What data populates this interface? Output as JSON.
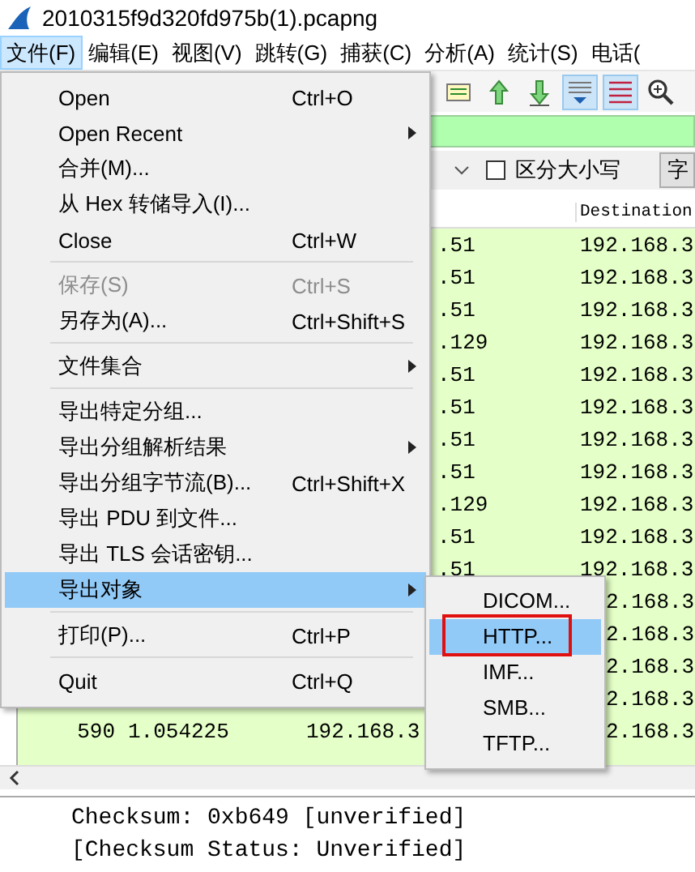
{
  "window": {
    "title": "2010315f9d320fd975b(1).pcapng"
  },
  "menubar": [
    {
      "label": "文件(F)",
      "selected": true
    },
    {
      "label": "编辑(E)",
      "selected": false
    },
    {
      "label": "视图(V)",
      "selected": false
    },
    {
      "label": "跳转(G)",
      "selected": false
    },
    {
      "label": "捕获(C)",
      "selected": false
    },
    {
      "label": "分析(A)",
      "selected": false
    },
    {
      "label": "统计(S)",
      "selected": false
    },
    {
      "label": "电话(",
      "selected": false
    }
  ],
  "toolbar": [
    {
      "pressed": false
    },
    {
      "pressed": false
    },
    {
      "pressed": false
    },
    {
      "pressed": true
    },
    {
      "pressed": true
    },
    {
      "pressed": false
    }
  ],
  "search": {
    "case_sensitive": {
      "label": "区分大小写",
      "checked": false
    },
    "button": "字"
  },
  "table": {
    "columns": [
      "Destination"
    ],
    "rows": [
      {
        "kind": "menu",
        "source": ".51",
        "destination": "192.168.3"
      },
      {
        "kind": "menu",
        "source": ".51",
        "destination": "192.168.3"
      },
      {
        "kind": "menu",
        "source": ".51",
        "destination": "192.168.3"
      },
      {
        "kind": "menu",
        "source": ".129",
        "destination": "192.168.3"
      },
      {
        "kind": "menu",
        "source": ".51",
        "destination": "192.168.3"
      },
      {
        "kind": "menu",
        "source": ".51",
        "destination": "192.168.3"
      },
      {
        "kind": "menu",
        "source": ".51",
        "destination": "192.168.3"
      },
      {
        "kind": "menu",
        "source": ".51",
        "destination": "192.168.3"
      },
      {
        "kind": "menu",
        "source": ".129",
        "destination": "192.168.3"
      },
      {
        "kind": "menu",
        "source": ".51",
        "destination": "192.168.3"
      },
      {
        "kind": "menu",
        "source": ".51",
        "destination": "192.168.3"
      },
      {
        "kind": "submenu",
        "destination": "2.168.3"
      },
      {
        "kind": "submenu",
        "destination": "2.168.3"
      },
      {
        "kind": "submenu",
        "destination": "2.168.3"
      },
      {
        "kind": "submenu",
        "destination": "2.168.3"
      },
      {
        "kind": "submenu",
        "no": "590",
        "time": "1.054225",
        "source": "192.168.3",
        "destination": "2.168.3"
      }
    ]
  },
  "details": [
    "Checksum: 0xb649 [unverified]",
    "[Checksum Status: Unverified]"
  ],
  "file_menu": [
    {
      "kind": "item",
      "label": "Open",
      "shortcut": "Ctrl+O",
      "submenu": false,
      "disabled": false,
      "selected": false
    },
    {
      "kind": "item",
      "label": "Open Recent",
      "submenu": true,
      "disabled": false,
      "selected": false
    },
    {
      "kind": "item",
      "label": "合并(M)...",
      "submenu": false,
      "disabled": false,
      "selected": false
    },
    {
      "kind": "item",
      "label": "从 Hex 转储导入(I)...",
      "submenu": false,
      "disabled": false,
      "selected": false
    },
    {
      "kind": "item",
      "label": "Close",
      "shortcut": "Ctrl+W",
      "submenu": false,
      "disabled": false,
      "selected": false
    },
    {
      "kind": "separator"
    },
    {
      "kind": "item",
      "label": "保存(S)",
      "shortcut": "Ctrl+S",
      "submenu": false,
      "disabled": true,
      "selected": false
    },
    {
      "kind": "item",
      "label": "另存为(A)...",
      "shortcut": "Ctrl+Shift+S",
      "submenu": false,
      "disabled": false,
      "selected": false
    },
    {
      "kind": "separator"
    },
    {
      "kind": "item",
      "label": "文件集合",
      "submenu": true,
      "disabled": false,
      "selected": false
    },
    {
      "kind": "separator"
    },
    {
      "kind": "item",
      "label": "导出特定分组...",
      "submenu": false,
      "disabled": false,
      "selected": false
    },
    {
      "kind": "item",
      "label": "导出分组解析结果",
      "submenu": true,
      "disabled": false,
      "selected": false
    },
    {
      "kind": "item",
      "label": "导出分组字节流(B)...",
      "shortcut": "Ctrl+Shift+X",
      "submenu": false,
      "disabled": false,
      "selected": false
    },
    {
      "kind": "item",
      "label": "导出 PDU 到文件...",
      "submenu": false,
      "disabled": false,
      "selected": false
    },
    {
      "kind": "item",
      "label": "导出 TLS 会话密钥...",
      "submenu": false,
      "disabled": false,
      "selected": false
    },
    {
      "kind": "item",
      "label": "导出对象",
      "submenu": true,
      "disabled": false,
      "selected": true
    },
    {
      "kind": "separator"
    },
    {
      "kind": "item",
      "label": "打印(P)...",
      "shortcut": "Ctrl+P",
      "submenu": false,
      "disabled": false,
      "selected": false
    },
    {
      "kind": "separator"
    },
    {
      "kind": "item",
      "label": "Quit",
      "shortcut": "Ctrl+Q",
      "submenu": false,
      "disabled": false,
      "selected": false
    }
  ],
  "export_objects_menu": [
    {
      "label": "DICOM...",
      "selected": false,
      "highlighted": false
    },
    {
      "label": "HTTP...",
      "selected": true,
      "highlighted": true
    },
    {
      "label": "IMF...",
      "selected": false,
      "highlighted": false
    },
    {
      "label": "SMB...",
      "selected": false,
      "highlighted": false
    },
    {
      "label": "TFTP...",
      "selected": false,
      "highlighted": false
    }
  ]
}
